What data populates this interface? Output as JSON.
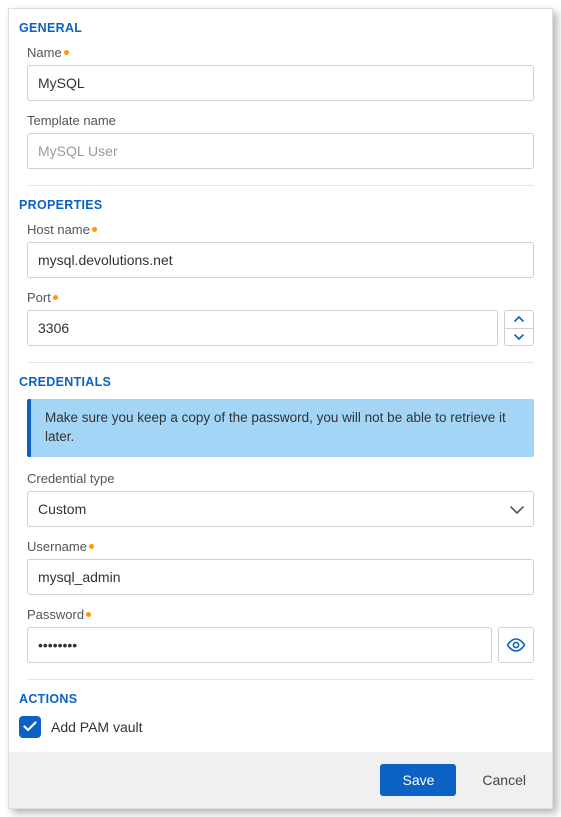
{
  "sections": {
    "general": {
      "title": "GENERAL",
      "name_label": "Name",
      "name_value": "MySQL",
      "template_label": "Template name",
      "template_placeholder": "MySQL User",
      "template_value": ""
    },
    "properties": {
      "title": "PROPERTIES",
      "host_label": "Host name",
      "host_value": "mysql.devolutions.net",
      "port_label": "Port",
      "port_value": "3306"
    },
    "credentials": {
      "title": "CREDENTIALS",
      "info_message": "Make sure you keep a copy of the password, you will not be able to retrieve it later.",
      "type_label": "Credential type",
      "type_value": "Custom",
      "username_label": "Username",
      "username_value": "mysql_admin",
      "password_label": "Password",
      "password_value": "••••••••"
    },
    "actions": {
      "title": "ACTIONS",
      "add_pam_label": "Add PAM vault",
      "add_pam_checked": true
    }
  },
  "footer": {
    "save_label": "Save",
    "cancel_label": "Cancel"
  },
  "colors": {
    "primary": "#0b62c4",
    "accent": "#ff9800",
    "info_bg": "#a3d5f7"
  }
}
